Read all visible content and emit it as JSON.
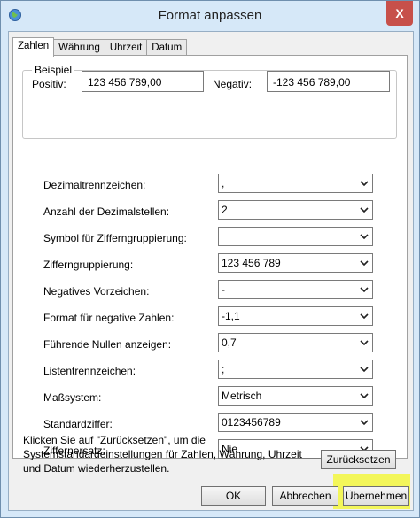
{
  "window": {
    "title": "Format anpassen",
    "close_symbol": "X"
  },
  "tabs": [
    {
      "label": "Zahlen",
      "active": true
    },
    {
      "label": "Währung",
      "active": false
    },
    {
      "label": "Uhrzeit",
      "active": false
    },
    {
      "label": "Datum",
      "active": false
    }
  ],
  "example": {
    "group_label": "Beispiel",
    "positive_label": "Positiv:",
    "positive_value": "123 456 789,00",
    "negative_label": "Negativ:",
    "negative_value": "-123 456 789,00"
  },
  "settings": [
    {
      "label": "Dezimaltrennzeichen:",
      "value": ","
    },
    {
      "label": "Anzahl der Dezimalstellen:",
      "value": "2"
    },
    {
      "label": "Symbol für Zifferngruppierung:",
      "value": ""
    },
    {
      "label": "Zifferngruppierung:",
      "value": "123 456 789"
    },
    {
      "label": "Negatives Vorzeichen:",
      "value": "-"
    },
    {
      "label": "Format für negative Zahlen:",
      "value": "-1,1"
    },
    {
      "label": "Führende Nullen anzeigen:",
      "value": "0,7"
    },
    {
      "label": "Listentrennzeichen:",
      "value": ";"
    },
    {
      "label": "Maßsystem:",
      "value": "Metrisch"
    },
    {
      "label": "Standardziffer:",
      "value": "0123456789"
    },
    {
      "label": "Ziffernersatz:",
      "value": "Nie"
    }
  ],
  "note": "Klicken Sie auf \"Zurücksetzen\", um die Systemstandardeinstellungen für Zahlen, Währung, Uhrzeit und Datum wiederherzustellen.",
  "buttons": {
    "reset": "Zurücksetzen",
    "ok": "OK",
    "cancel": "Abbrechen",
    "apply": "Übernehmen"
  },
  "colors": {
    "highlight": "#f3f65a",
    "close": "#c7504a",
    "frame": "#d6e8f8"
  }
}
